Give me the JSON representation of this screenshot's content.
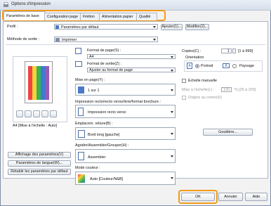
{
  "window": {
    "title": "Options d'impression"
  },
  "tabs": [
    "Paramètres de base",
    "Configuration page",
    "Finition",
    "Alimentation papier",
    "Qualité"
  ],
  "profile": {
    "label": "Profil :",
    "value": "Paramètres par défaut",
    "add": "Ajouter(1)...",
    "edit": "Modifier(2)..."
  },
  "output": {
    "label": "Méthode de sortie :",
    "value": "Imprimer"
  },
  "preview": {
    "caption": "A4 [Mise à l'échelle : Auto]"
  },
  "left_buttons": [
    "Affichage des paramètres(V)",
    "Paramètres de langue(W)...",
    "Rétablir les paramètres par défaut"
  ],
  "page_size": {
    "label": "Format de page(S) :",
    "value": "A4"
  },
  "output_size": {
    "label": "Format de sortie(Z) :",
    "value": "Ajuster au format de page"
  },
  "copies": {
    "label": "Copies(C) :",
    "value": "1",
    "range": "[1 à 999]"
  },
  "orientation": {
    "label": "Orientation",
    "portrait": "Portrait",
    "landscape": "Paysage",
    "selected": "portrait"
  },
  "nup": {
    "label": "Mise en page(Y) :",
    "value": "1 sur 1"
  },
  "manual_scaling": {
    "label": "Échelle manuelle",
    "scale_label": "Mise à l'échelle(L) :",
    "value": "100",
    "range": "% [25 à 200]",
    "origin": "Origine au centre(5)"
  },
  "duplex": {
    "label": "Impression recto/recto verso/livre/format brochure :",
    "value": "Impression recto verso"
  },
  "binding": {
    "label": "Emplacem. reliure(B) :",
    "value": "Bord long [gauche]",
    "gutter": "Gouttière..."
  },
  "staple": {
    "label": "Agrafer/Assembler/Grouper(H) :",
    "value": "Assembler"
  },
  "color": {
    "label": "Mode couleur :",
    "value": "Auto [Couleur/N&B]"
  },
  "footer": {
    "ok": "OK",
    "cancel": "Annuler",
    "help": "Aide"
  },
  "colors": {
    "accent": "#f29a1a",
    "selection": "#2f6fd1"
  }
}
